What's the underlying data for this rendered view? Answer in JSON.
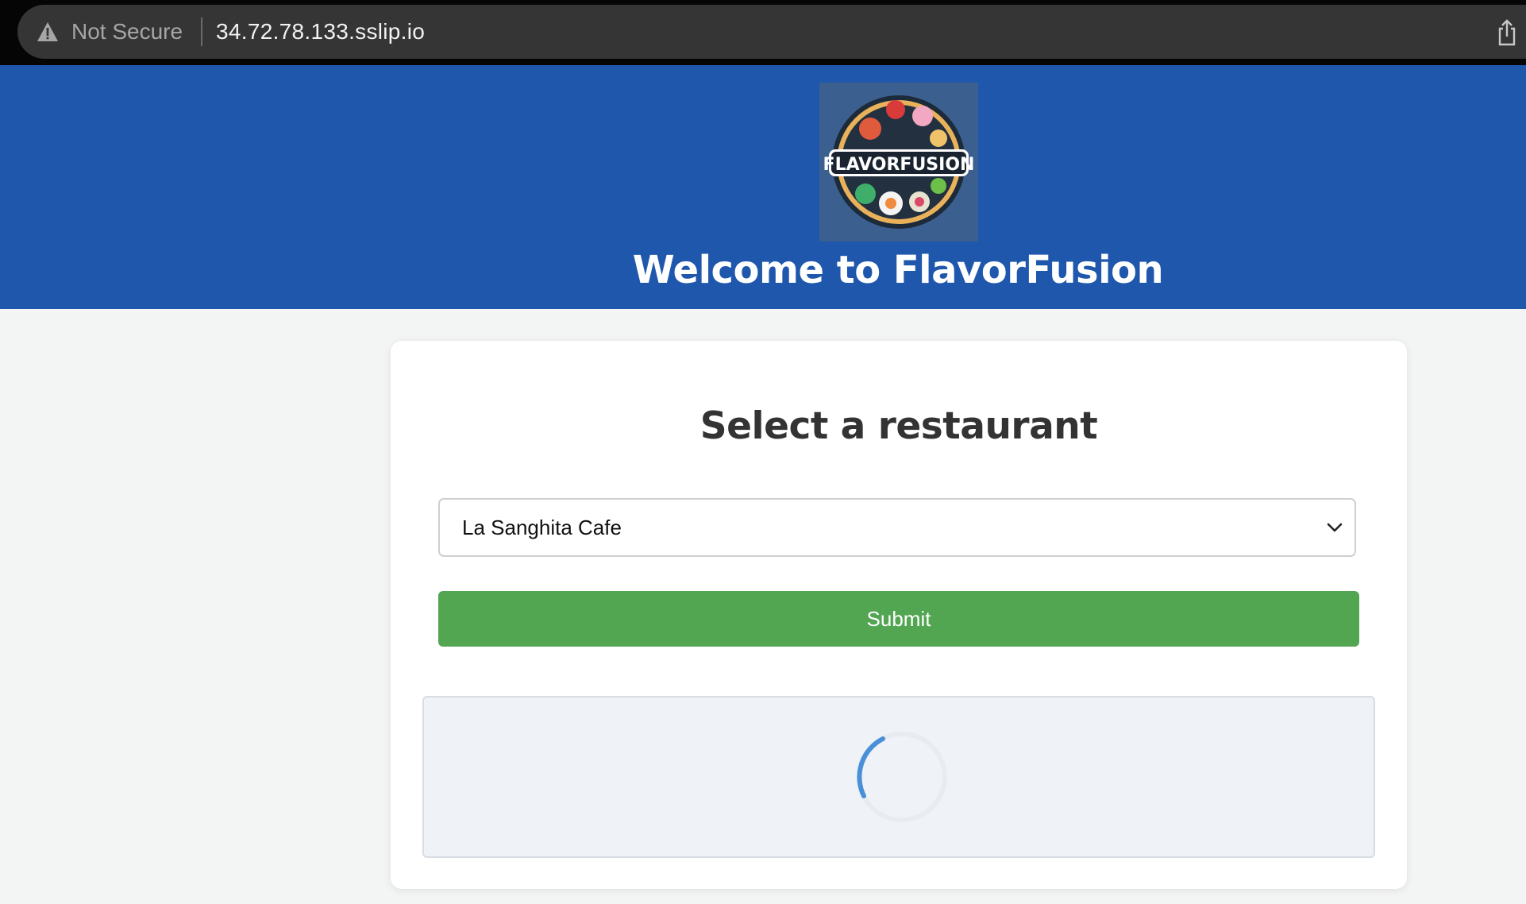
{
  "browser": {
    "security_label": "Not Secure",
    "url": "34.72.78.133.sslip.io",
    "icons": [
      "warning-icon",
      "share-icon"
    ]
  },
  "header": {
    "logo_text": "FLAVORFUSION",
    "title": "Welcome to FlavorFusion",
    "background_color": "#1f57ad"
  },
  "main": {
    "heading": "Select a restaurant",
    "restaurant_select": {
      "selected": "La Sanghita Cafe"
    },
    "submit_label": "Submit",
    "submit_color": "#52a551",
    "result_panel": {
      "state": "loading",
      "spinner_color": "#4a90d9"
    }
  }
}
